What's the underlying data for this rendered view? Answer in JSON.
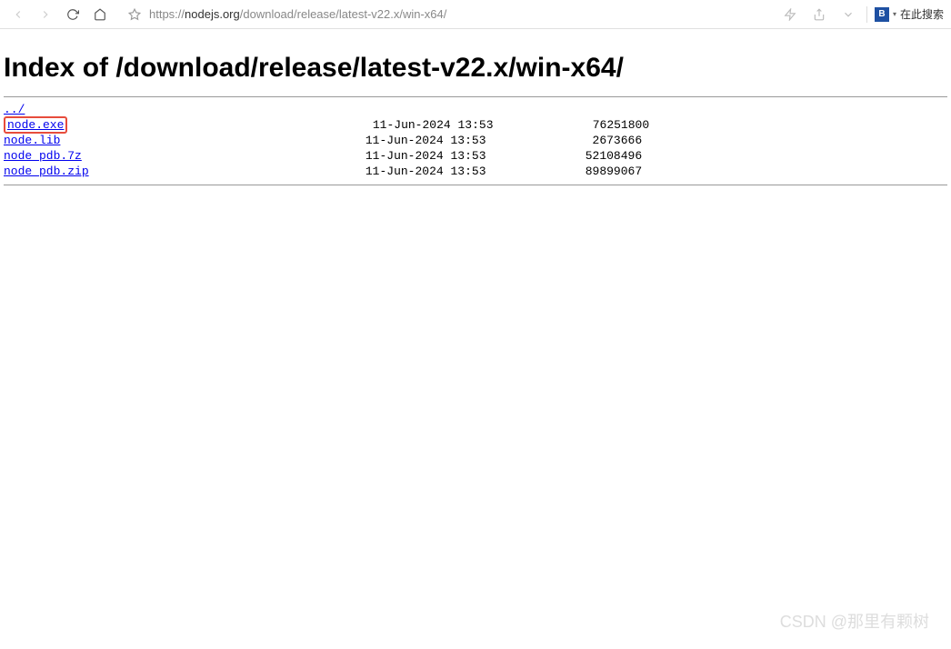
{
  "toolbar": {
    "url_protocol": "https://",
    "url_domain": "nodejs.org",
    "url_path": "/download/release/latest-v22.x/win-x64/",
    "search_placeholder": "在此搜索"
  },
  "page": {
    "title": "Index of /download/release/latest-v22.x/win-x64/"
  },
  "listing": {
    "parent_dir": "../",
    "files": [
      {
        "name": "node.exe",
        "date": "11-Jun-2024 13:53",
        "size": "76251800",
        "highlighted": true
      },
      {
        "name": "node.lib",
        "date": "11-Jun-2024 13:53",
        "size": "2673666",
        "highlighted": false
      },
      {
        "name": "node_pdb.7z",
        "date": "11-Jun-2024 13:53",
        "size": "52108496",
        "highlighted": false
      },
      {
        "name": "node_pdb.zip",
        "date": "11-Jun-2024 13:53",
        "size": "89899067",
        "highlighted": false
      }
    ]
  },
  "watermark": "CSDN @那里有颗树"
}
